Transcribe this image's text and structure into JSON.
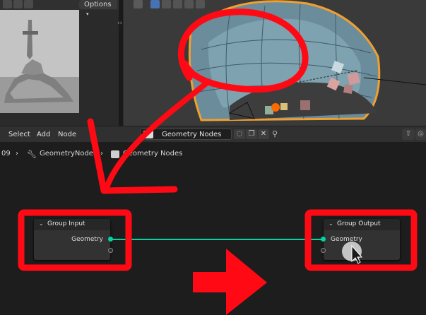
{
  "image_editor": {
    "options_label": "Options"
  },
  "node_editor": {
    "menu": [
      "Select",
      "Add",
      "Node"
    ],
    "node_group_name": "Geometry Nodes",
    "breadcrumb": {
      "prefix": "09",
      "modifier": "GeometryNodes",
      "group": "Geometry Nodes"
    }
  },
  "nodes": {
    "group_input": {
      "title": "Group Input",
      "socket_label": "Geometry"
    },
    "group_output": {
      "title": "Group Output",
      "socket_label": "Geometry"
    }
  },
  "colors": {
    "annotation_red": "#ff0a14",
    "geometry_socket": "#00d6a3",
    "selection_orange": "#f0a030"
  },
  "icons": [
    "dropdown-icon",
    "shield-icon",
    "copy-icon",
    "close-icon",
    "pin-icon",
    "wrench-icon",
    "node-tree-icon",
    "chevron-down-icon",
    "mouse-cursor-icon"
  ]
}
